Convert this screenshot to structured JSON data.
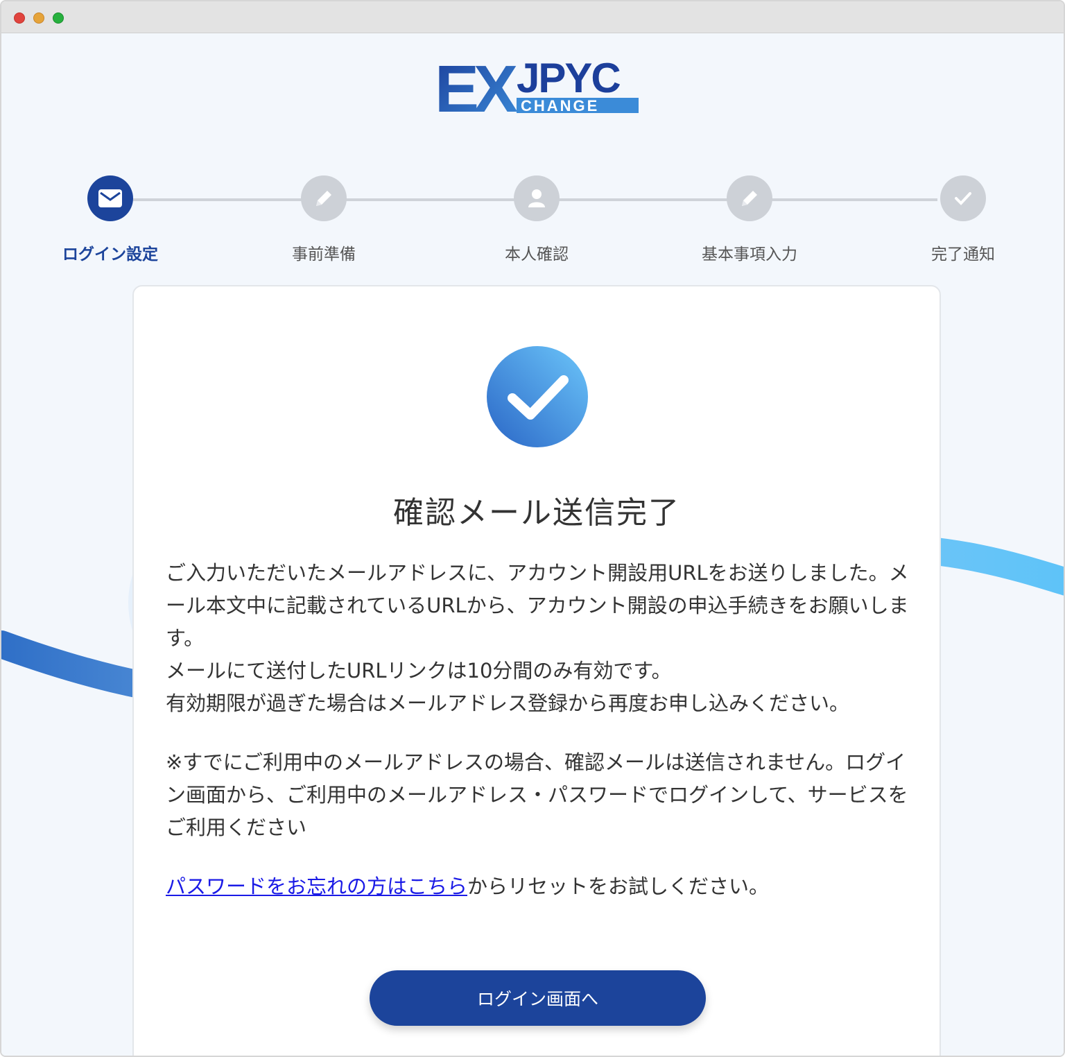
{
  "window": {
    "title": ""
  },
  "header": {
    "logo_text_main": "JPYC",
    "logo_text_ex": "EX",
    "logo_text_sub": "CHANGE"
  },
  "stepper": {
    "steps": [
      {
        "label": "ログイン設定",
        "icon": "mail-icon",
        "active": true
      },
      {
        "label": "事前準備",
        "icon": "pencil-icon",
        "active": false
      },
      {
        "label": "本人確認",
        "icon": "person-icon",
        "active": false
      },
      {
        "label": "基本事項入力",
        "icon": "pencil-icon",
        "active": false
      },
      {
        "label": "完了通知",
        "icon": "check-icon",
        "active": false
      }
    ]
  },
  "card": {
    "title": "確認メール送信完了",
    "paragraph1": "ご入力いただいたメールアドレスに、アカウント開設用URLをお送りしました。メール本文中に記載されているURLから、アカウント開設の申込手続きをお願いします。",
    "paragraph2": "メールにて送付したURLリンクは10分間のみ有効です。",
    "paragraph3": "有効期限が過ぎた場合はメールアドレス登録から再度お申し込みください。",
    "paragraph4": "※すでにご利用中のメールアドレスの場合、確認メールは送信されません。ログイン画面から、ご利用中のメールアドレス・パスワードでログインして、サービスをご利用ください",
    "reset_link": "パスワードをお忘れの方はこちら",
    "reset_suffix": "からリセットをお試しください。",
    "login_button": "ログイン画面へ"
  },
  "colors": {
    "primary": "#1c449b",
    "link": "#1a1ae6",
    "inactive_step": "#cdd1d7"
  }
}
